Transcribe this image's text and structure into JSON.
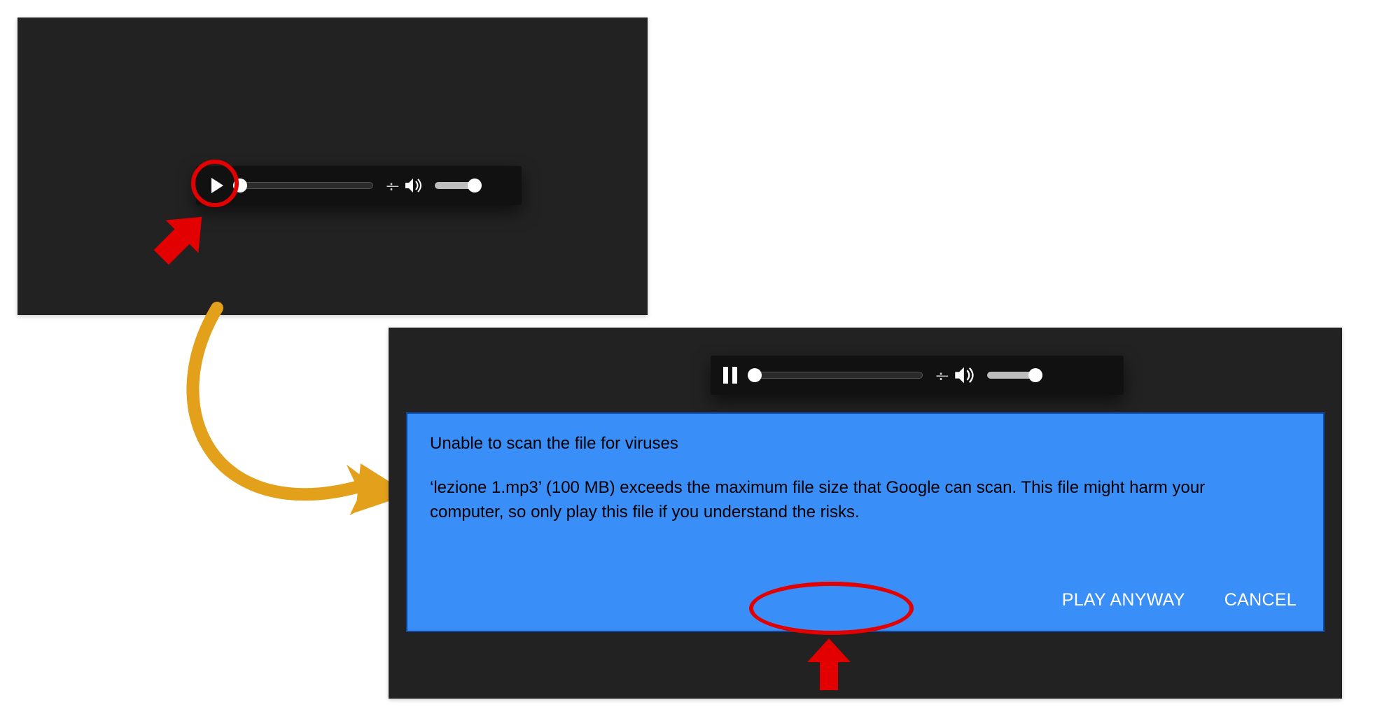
{
  "panel1": {
    "player": {
      "state": "paused",
      "time_separator": "-:—"
    }
  },
  "panel2": {
    "player": {
      "state": "playing",
      "time_separator": "-:—"
    },
    "dialog": {
      "title": "Unable to scan the file for viruses",
      "body": "‘lezione 1.mp3’ (100 MB) exceeds the maximum file size that Google can scan. This file might harm your computer, so only play this file if you understand the risks.",
      "actions": {
        "play_anyway": "PLAY ANYWAY",
        "cancel": "CANCEL"
      }
    }
  },
  "annotations": {
    "circle_play_button": "highlight-play-button",
    "arrow_to_play": "arrow-to-play-button",
    "curved_arrow": "step-arrow-panel1-to-panel2",
    "ellipse_play_anyway": "highlight-play-anyway",
    "arrow_to_play_anyway": "arrow-to-play-anyway"
  },
  "colors": {
    "panel_bg": "#222222",
    "dialog_bg": "#3a8ef7",
    "dialog_border": "#0b47a1",
    "annotation_red": "#e30000",
    "annotation_yellow": "#e3a01b"
  }
}
